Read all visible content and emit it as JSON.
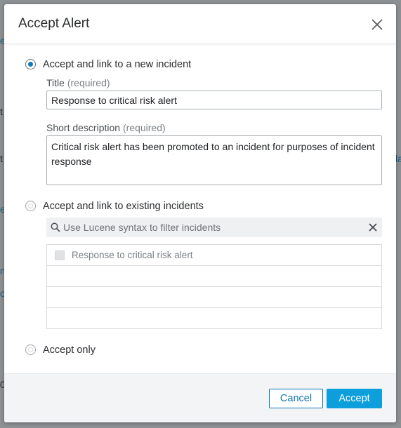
{
  "background": {
    "fragments": [
      "e",
      "t",
      "t",
      "la",
      "e",
      "n",
      "o",
      "0"
    ]
  },
  "dialog": {
    "title": "Accept Alert",
    "close_icon": "close-icon"
  },
  "options": {
    "new_incident": {
      "label": "Accept and link to a new incident",
      "selected": true,
      "title_label": "Title",
      "title_required": "(required)",
      "title_value": "Response to critical risk alert",
      "desc_label": "Short description",
      "desc_required": "(required)",
      "desc_value": "Critical risk alert has been promoted to an incident for purposes of incident response"
    },
    "existing_incidents": {
      "label": "Accept and link to existing incidents",
      "selected": false,
      "search_placeholder": "Use Lucene syntax to filter incidents",
      "search_icon": "search-icon",
      "clear_icon": "close-icon",
      "rows": [
        {
          "label": "Response to critical risk alert"
        },
        {
          "label": ""
        },
        {
          "label": ""
        },
        {
          "label": ""
        }
      ]
    },
    "accept_only": {
      "label": "Accept only",
      "selected": false
    }
  },
  "footer": {
    "cancel_label": "Cancel",
    "accept_label": "Accept"
  },
  "colors": {
    "accent": "#0d9fdc",
    "link": "#0d74b0",
    "radio_dot": "#0f7ab8"
  }
}
